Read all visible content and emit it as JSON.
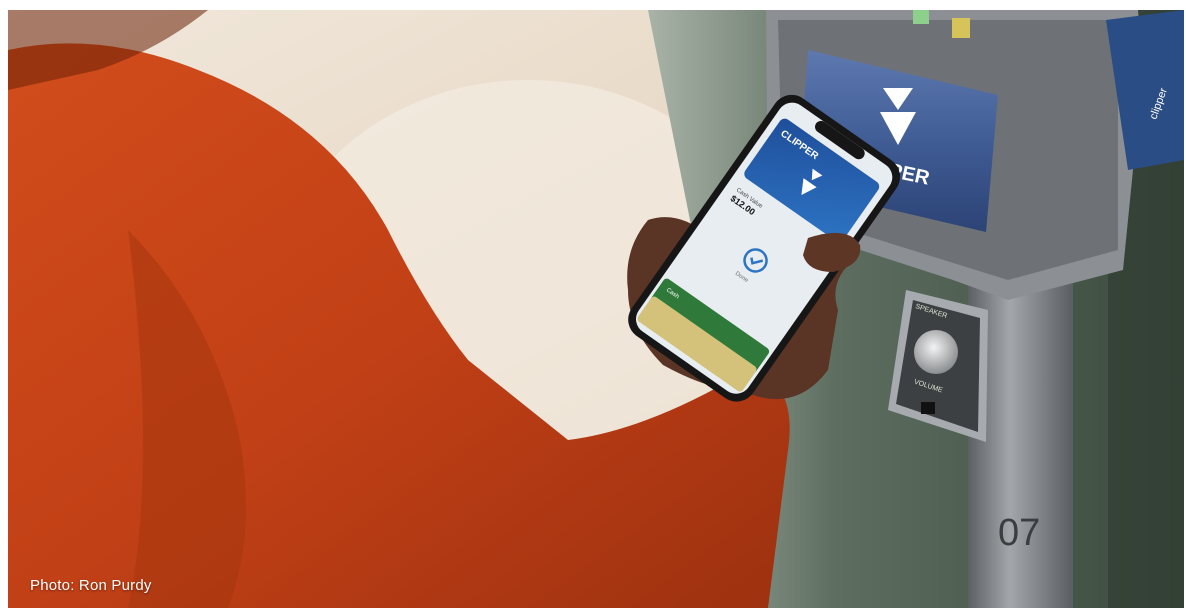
{
  "photo": {
    "credit": "Photo: Ron Purdy"
  },
  "reader": {
    "brand": "CLIPPER",
    "side_brand": "clipper",
    "speaker_label": "SPEAKER",
    "volume_label": "VOLUME",
    "pole_number": "07"
  },
  "phone": {
    "card_brand": "CLIPPER",
    "balance_label": "Cash Value",
    "balance_value": "$12.00",
    "status_label": "Done",
    "second_card_label": "Cash"
  },
  "colors": {
    "jacket": "#c8461a",
    "reader_screen": "#3d5a93",
    "pole": "#7d8185",
    "wall": "#e9dccb",
    "column": "#4a5a4c"
  }
}
